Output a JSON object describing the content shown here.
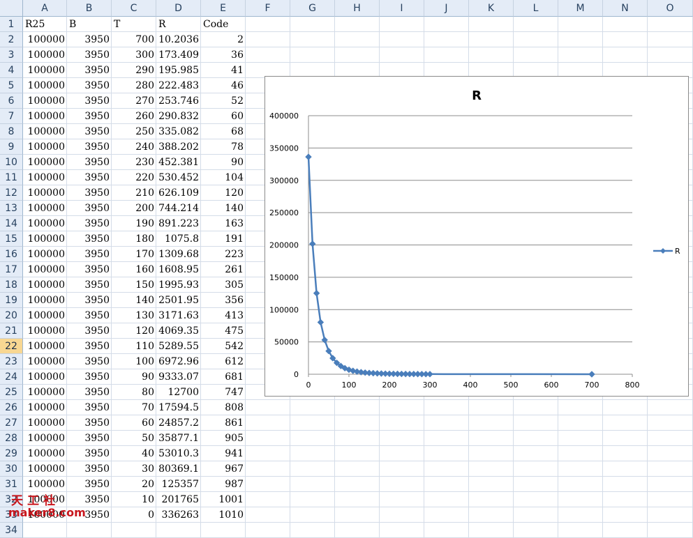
{
  "spreadsheet": {
    "columns": [
      "A",
      "B",
      "C",
      "D",
      "E",
      "F",
      "G",
      "H",
      "I",
      "J",
      "K",
      "L",
      "M",
      "N",
      "O"
    ],
    "header_row": [
      "R25",
      "B",
      "T",
      "R",
      "Code"
    ],
    "selected_row": 22,
    "rows": [
      {
        "n": "2",
        "a": "100000",
        "b": "3950",
        "c": "700",
        "d": "10.2036",
        "e": "2"
      },
      {
        "n": "3",
        "a": "100000",
        "b": "3950",
        "c": "300",
        "d": "173.409",
        "e": "36"
      },
      {
        "n": "4",
        "a": "100000",
        "b": "3950",
        "c": "290",
        "d": "195.985",
        "e": "41"
      },
      {
        "n": "5",
        "a": "100000",
        "b": "3950",
        "c": "280",
        "d": "222.483",
        "e": "46"
      },
      {
        "n": "6",
        "a": "100000",
        "b": "3950",
        "c": "270",
        "d": "253.746",
        "e": "52"
      },
      {
        "n": "7",
        "a": "100000",
        "b": "3950",
        "c": "260",
        "d": "290.832",
        "e": "60"
      },
      {
        "n": "8",
        "a": "100000",
        "b": "3950",
        "c": "250",
        "d": "335.082",
        "e": "68"
      },
      {
        "n": "9",
        "a": "100000",
        "b": "3950",
        "c": "240",
        "d": "388.202",
        "e": "78"
      },
      {
        "n": "10",
        "a": "100000",
        "b": "3950",
        "c": "230",
        "d": "452.381",
        "e": "90"
      },
      {
        "n": "11",
        "a": "100000",
        "b": "3950",
        "c": "220",
        "d": "530.452",
        "e": "104"
      },
      {
        "n": "12",
        "a": "100000",
        "b": "3950",
        "c": "210",
        "d": "626.109",
        "e": "120"
      },
      {
        "n": "13",
        "a": "100000",
        "b": "3950",
        "c": "200",
        "d": "744.214",
        "e": "140"
      },
      {
        "n": "14",
        "a": "100000",
        "b": "3950",
        "c": "190",
        "d": "891.223",
        "e": "163"
      },
      {
        "n": "15",
        "a": "100000",
        "b": "3950",
        "c": "180",
        "d": "1075.8",
        "e": "191"
      },
      {
        "n": "16",
        "a": "100000",
        "b": "3950",
        "c": "170",
        "d": "1309.68",
        "e": "223"
      },
      {
        "n": "17",
        "a": "100000",
        "b": "3950",
        "c": "160",
        "d": "1608.95",
        "e": "261"
      },
      {
        "n": "18",
        "a": "100000",
        "b": "3950",
        "c": "150",
        "d": "1995.93",
        "e": "305"
      },
      {
        "n": "19",
        "a": "100000",
        "b": "3950",
        "c": "140",
        "d": "2501.95",
        "e": "356"
      },
      {
        "n": "20",
        "a": "100000",
        "b": "3950",
        "c": "130",
        "d": "3171.63",
        "e": "413"
      },
      {
        "n": "21",
        "a": "100000",
        "b": "3950",
        "c": "120",
        "d": "4069.35",
        "e": "475"
      },
      {
        "n": "22",
        "a": "100000",
        "b": "3950",
        "c": "110",
        "d": "5289.55",
        "e": "542"
      },
      {
        "n": "23",
        "a": "100000",
        "b": "3950",
        "c": "100",
        "d": "6972.96",
        "e": "612"
      },
      {
        "n": "24",
        "a": "100000",
        "b": "3950",
        "c": "90",
        "d": "9333.07",
        "e": "681"
      },
      {
        "n": "25",
        "a": "100000",
        "b": "3950",
        "c": "80",
        "d": "12700",
        "e": "747"
      },
      {
        "n": "26",
        "a": "100000",
        "b": "3950",
        "c": "70",
        "d": "17594.5",
        "e": "808"
      },
      {
        "n": "27",
        "a": "100000",
        "b": "3950",
        "c": "60",
        "d": "24857.2",
        "e": "861"
      },
      {
        "n": "28",
        "a": "100000",
        "b": "3950",
        "c": "50",
        "d": "35877.1",
        "e": "905"
      },
      {
        "n": "29",
        "a": "100000",
        "b": "3950",
        "c": "40",
        "d": "53010.3",
        "e": "941"
      },
      {
        "n": "30",
        "a": "100000",
        "b": "3950",
        "c": "30",
        "d": "80369.1",
        "e": "967"
      },
      {
        "n": "31",
        "a": "100000",
        "b": "3950",
        "c": "20",
        "d": "125357",
        "e": "987"
      },
      {
        "n": "32",
        "a": "100000",
        "b": "3950",
        "c": "10",
        "d": "201765",
        "e": "1001"
      },
      {
        "n": "33",
        "a": "100000",
        "b": "3950",
        "c": "0",
        "d": "336263",
        "e": "1010"
      }
    ]
  },
  "chart_data": {
    "type": "scatter",
    "title": "R",
    "xlabel": "",
    "ylabel": "",
    "xlim": [
      0,
      800
    ],
    "ylim": [
      0,
      400000
    ],
    "xticks": [
      "0",
      "100",
      "200",
      "300",
      "400",
      "500",
      "600",
      "700",
      "800"
    ],
    "yticks": [
      "0",
      "50000",
      "100000",
      "150000",
      "200000",
      "250000",
      "300000",
      "350000",
      "400000"
    ],
    "grid": "horizontal",
    "legend": "right",
    "color": "#4a7ebb",
    "series": [
      {
        "name": "R",
        "x": [
          700,
          300,
          290,
          280,
          270,
          260,
          250,
          240,
          230,
          220,
          210,
          200,
          190,
          180,
          170,
          160,
          150,
          140,
          130,
          120,
          110,
          100,
          90,
          80,
          70,
          60,
          50,
          40,
          30,
          20,
          10,
          0
        ],
        "y": [
          10.2036,
          173.409,
          195.985,
          222.483,
          253.746,
          290.832,
          335.082,
          388.202,
          452.381,
          530.452,
          626.109,
          744.214,
          891.223,
          1075.8,
          1309.68,
          1608.95,
          1995.93,
          2501.95,
          3171.63,
          4069.35,
          5289.55,
          6972.96,
          9333.07,
          12700,
          17594.5,
          24857.2,
          35877.1,
          53010.3,
          80369.1,
          125357,
          201765,
          336263
        ]
      }
    ]
  },
  "watermark": {
    "cn": "天工社",
    "url": "maker8.com"
  }
}
